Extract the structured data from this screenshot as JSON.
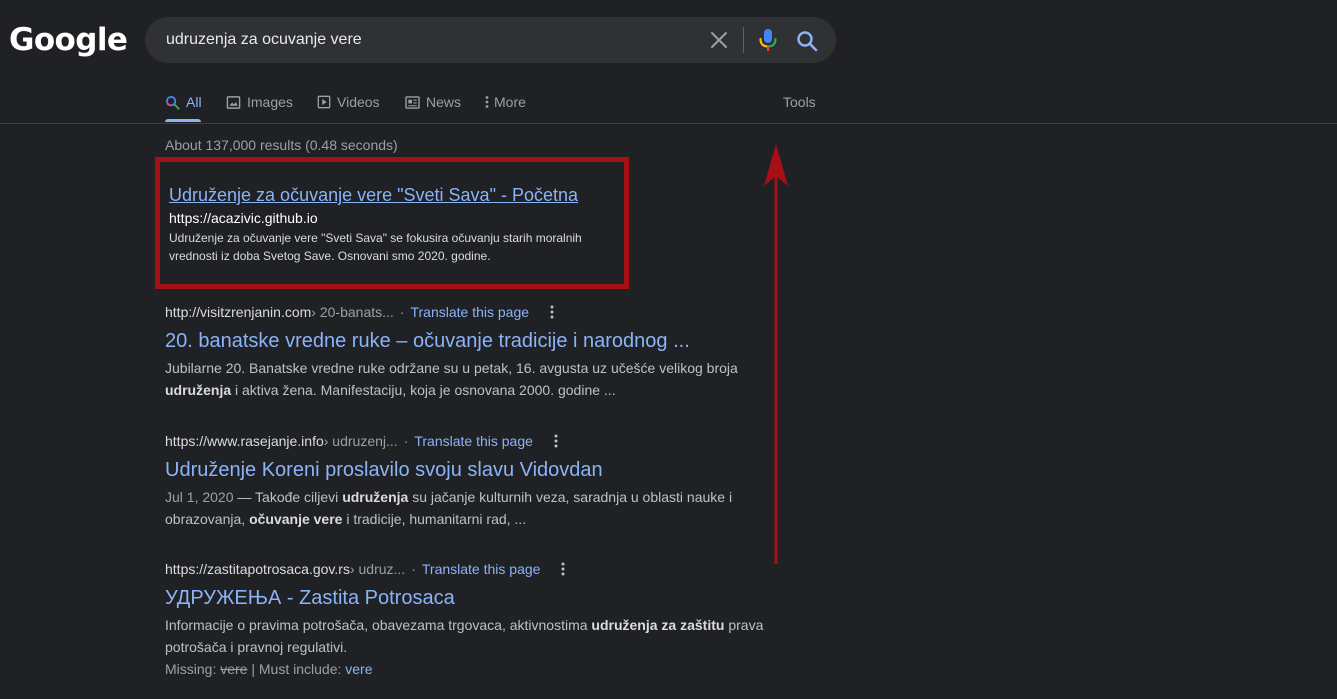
{
  "logo": "Google",
  "search": {
    "query": "udruzenja za ocuvanje vere"
  },
  "tabs": [
    {
      "label": "All",
      "icon": "search-icon",
      "active": true
    },
    {
      "label": "Images",
      "icon": "image-icon"
    },
    {
      "label": "Videos",
      "icon": "video-icon"
    },
    {
      "label": "News",
      "icon": "news-icon"
    },
    {
      "label": "More",
      "icon": "more-vert-icon"
    }
  ],
  "tools_label": "Tools",
  "stats": "About 137,000 results (0.48 seconds)",
  "annotation": {
    "box_color": "#a60f16",
    "arrow_color": "#a60f16"
  },
  "results": [
    {
      "title": "Udruženje za očuvanje vere \"Sveti Sava\" - Početna",
      "url": "https://acazivic.github.io",
      "snippet_line1": "Udruženje za očuvanje vere \"Sveti Sava\" se fokusira očuvanju starih moralnih",
      "snippet_line2": "vrednosti iz doba Svetog Save. Osnovani smo 2020. godine."
    },
    {
      "site": "http://visitzrenjanin.com",
      "path": " › 20-banats...",
      "translate": "Translate this page",
      "title": "20. banatske vredne ruke – očuvanje tradicije i narodnog ...",
      "snippet": {
        "l1": "Jubilarne 20. Banatske vredne ruke održane su u petak, 16. avgusta uz učešće velikog broja",
        "l2_b1": "udruženja",
        "l2_t1": " i aktiva žena. Manifestaciju, koja je osnovana 2000. godine ..."
      }
    },
    {
      "site": "https://www.rasejanje.info",
      "path": " › udruzenj...",
      "translate": "Translate this page",
      "title": "Udruženje Koreni proslavilo svoju slavu Vidovdan",
      "snippet": {
        "date": "Jul 1, 2020",
        "t1": " — Takođe ciljevi ",
        "b1": "udruženja",
        "t2": " su jačanje kulturnih veza, saradnja u oblasti nauke i",
        "t3": "obrazovanja, ",
        "b2": "očuvanje vere",
        "t4": " i tradicije, humanitarni rad, ..."
      }
    },
    {
      "site": "https://zastitapotrosaca.gov.rs",
      "path": " › udruz...",
      "translate": "Translate this page",
      "title": "УДРУЖЕЊА - Zastita Potrosaca",
      "snippet": {
        "t1": "Informacije o pravima potrošača, obavezama trgovaca, aktivnostima ",
        "b1": "udruženja za zaštitu",
        "t2": " prava",
        "t3": "potrošača i pravnoj regulativi."
      },
      "missing_label": "Missing: ",
      "missing_word": "vere",
      "must_include_label": " | Must include: ",
      "must_include_word": "vere"
    }
  ]
}
